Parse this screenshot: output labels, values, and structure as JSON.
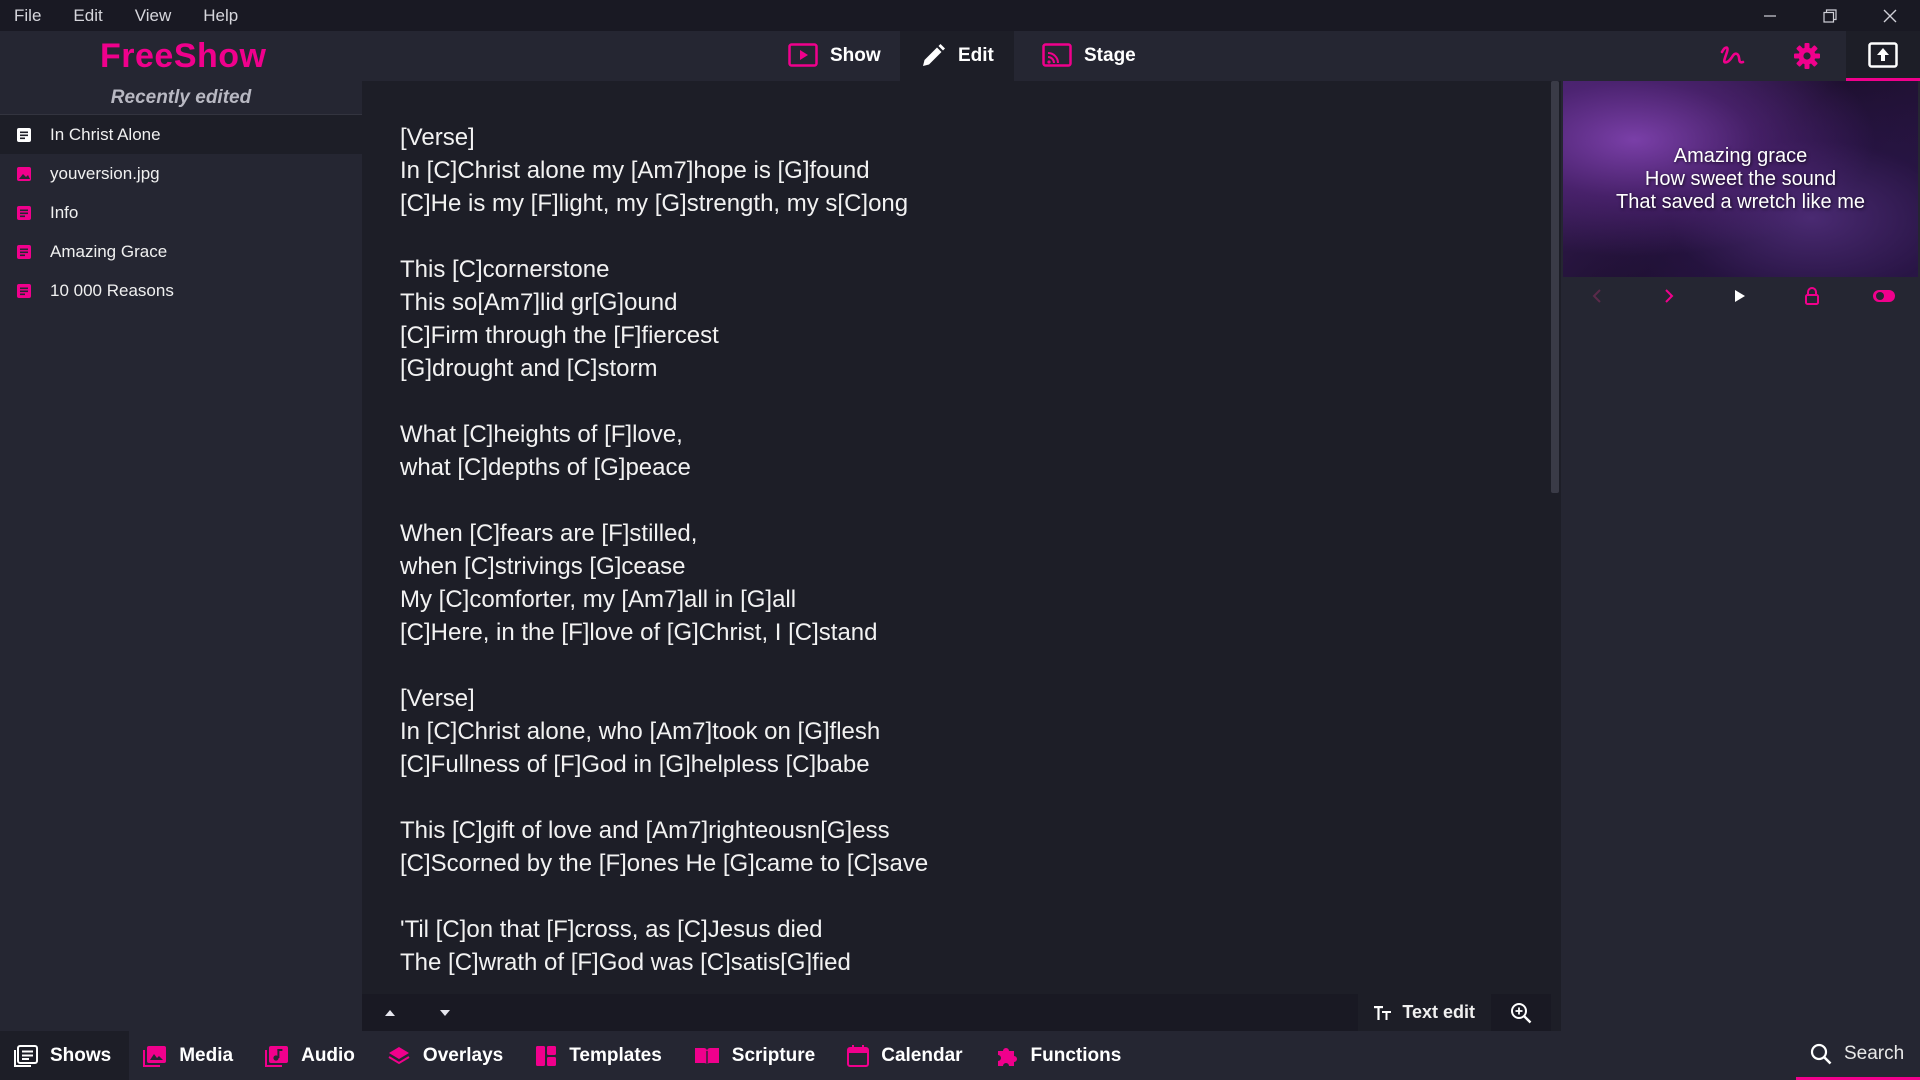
{
  "colors": {
    "accent": "#f0008c",
    "background": "#1d1e27",
    "panel": "#252632"
  },
  "menu": [
    "File",
    "Edit",
    "View",
    "Help"
  ],
  "app": {
    "logo": "FreeShow"
  },
  "modes": {
    "show": "Show",
    "edit": "Edit",
    "stage": "Stage"
  },
  "left": {
    "title": "Recently edited",
    "items": [
      {
        "label": "In Christ Alone",
        "icon": "show-icon"
      },
      {
        "label": "youversion.jpg",
        "icon": "image-icon"
      },
      {
        "label": "Info",
        "icon": "show-icon"
      },
      {
        "label": "Amazing Grace",
        "icon": "show-icon"
      },
      {
        "label": "10 000 Reasons",
        "icon": "show-icon"
      }
    ]
  },
  "editor": {
    "lines": [
      "[Verse]",
      "In [C]Christ alone my [Am7]hope is [G]found",
      "[C]He is my [F]light, my [G]strength, my s[C]ong",
      "",
      "This [C]cornerstone",
      "This so[Am7]lid gr[G]ound",
      "[C]Firm through the [F]fiercest",
      "[G]drought and [C]storm",
      "",
      "What [C]heights of [F]love,",
      "what [C]depths of [G]peace",
      "",
      "When [C]fears are [F]stilled,",
      "when [C]strivings [G]cease",
      "My [C]comforter, my [Am7]all in [G]all",
      "[C]Here, in the [F]love of [G]Christ, I [C]stand",
      "",
      "[Verse]",
      "In [C]Christ alone, who [Am7]took on [G]flesh",
      "[C]Fullness of [F]God in [G]helpless [C]babe",
      "",
      "This [C]gift of love and [Am7]righteousn[G]ess",
      "[C]Scorned by the [F]ones He [G]came to [C]save",
      "",
      "'Til [C]on that [F]cross, as [C]Jesus died",
      "The [C]wrath of [F]God was [C]satis[G]fied"
    ],
    "text_edit_label": "Text edit"
  },
  "preview": {
    "lines": [
      "Amazing grace",
      "How sweet the sound",
      "That saved a wretch like me"
    ]
  },
  "drawer": {
    "tabs": [
      {
        "label": "Shows",
        "icon": "shows-icon"
      },
      {
        "label": "Media",
        "icon": "media-icon"
      },
      {
        "label": "Audio",
        "icon": "audio-icon"
      },
      {
        "label": "Overlays",
        "icon": "overlays-icon"
      },
      {
        "label": "Templates",
        "icon": "templates-icon"
      },
      {
        "label": "Scripture",
        "icon": "scripture-icon"
      },
      {
        "label": "Calendar",
        "icon": "calendar-icon"
      },
      {
        "label": "Functions",
        "icon": "functions-icon"
      }
    ],
    "search_label": "Search"
  }
}
